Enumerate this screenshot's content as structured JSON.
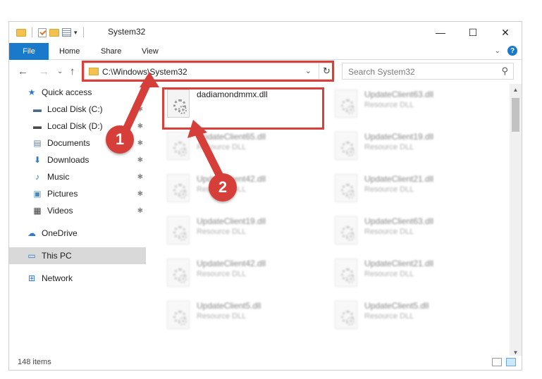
{
  "window": {
    "title": "System32",
    "controls": {
      "minimize": "—",
      "maximize": "☐",
      "close": "✕"
    }
  },
  "ribbon": {
    "tabs": [
      "File",
      "Home",
      "Share",
      "View"
    ],
    "expand_glyph": "⌄",
    "help_glyph": "?"
  },
  "nav": {
    "back": "←",
    "forward": "→",
    "recent": "⌄",
    "up": "↑",
    "address": "C:\\Windows\\System32",
    "address_drop": "⌄",
    "refresh": "↻",
    "search_placeholder": "Search System32",
    "search_icon": "⚲"
  },
  "sidebar": {
    "items": [
      {
        "label": "Quick access",
        "icon": "star-icon",
        "glyph": "★",
        "color": "#2b79d0",
        "pinned": false
      },
      {
        "label": "Local Disk (C:)",
        "icon": "drive-icon",
        "glyph": "▬",
        "color": "#4a6a8a",
        "pinned": true
      },
      {
        "label": "Local Disk (D:)",
        "icon": "drive-icon",
        "glyph": "▬",
        "color": "#4a4a4a",
        "pinned": true
      },
      {
        "label": "Documents",
        "icon": "documents-icon",
        "glyph": "▤",
        "color": "#6a7f99",
        "pinned": true
      },
      {
        "label": "Downloads",
        "icon": "downloads-icon",
        "glyph": "⬇",
        "color": "#2b79d0",
        "pinned": true
      },
      {
        "label": "Music",
        "icon": "music-icon",
        "glyph": "♪",
        "color": "#2b79d0",
        "pinned": true
      },
      {
        "label": "Pictures",
        "icon": "pictures-icon",
        "glyph": "▣",
        "color": "#4a8ac4",
        "pinned": true
      },
      {
        "label": "Videos",
        "icon": "videos-icon",
        "glyph": "▦",
        "color": "#3a3a3a",
        "pinned": true
      },
      {
        "label": "OneDrive",
        "icon": "onedrive-icon",
        "glyph": "☁",
        "color": "#2b79d0",
        "pinned": false
      },
      {
        "label": "This PC",
        "icon": "pc-icon",
        "glyph": "▭",
        "color": "#2b79d0",
        "pinned": false
      },
      {
        "label": "Network",
        "icon": "network-icon",
        "glyph": "⊞",
        "color": "#2b79d0",
        "pinned": false
      }
    ],
    "pin_glyph": "📌"
  },
  "files": {
    "selected": {
      "name": "dadiamondmmx.dll",
      "type": ""
    },
    "left": [
      {
        "name": "UpdateClient65.dll",
        "type": "Resource DLL"
      },
      {
        "name": "UpdateClient42.dll",
        "type": "Resource DLL"
      },
      {
        "name": "UpdateClient19.dll",
        "type": "Resource DLL"
      },
      {
        "name": "UpdateClient42.dll",
        "type": "Resource DLL"
      },
      {
        "name": "UpdateClient5.dll",
        "type": "Resource DLL"
      }
    ],
    "right": [
      {
        "name": "UpdateClient63.dll",
        "type": "Resource DLL"
      },
      {
        "name": "UpdateClient19.dll",
        "type": "Resource DLL"
      },
      {
        "name": "UpdateClient21.dll",
        "type": "Resource DLL"
      },
      {
        "name": "UpdateClient63.dll",
        "type": "Resource DLL"
      },
      {
        "name": "UpdateClient21.dll",
        "type": "Resource DLL"
      },
      {
        "name": "UpdateClient5.dll",
        "type": "Resource DLL"
      }
    ]
  },
  "status": {
    "count": "148 items"
  },
  "annotations": {
    "step1": "1",
    "step2": "2",
    "color": "#d63e3a"
  },
  "scroll": {
    "up": "▲",
    "down": "▼"
  }
}
